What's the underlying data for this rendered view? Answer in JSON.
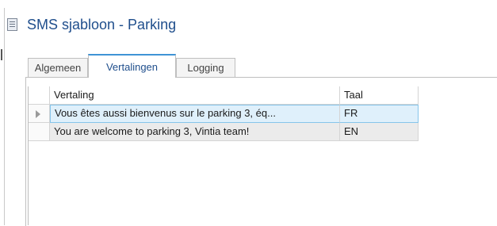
{
  "window": {
    "title": "SMS sjabloon - Parking"
  },
  "tabs": [
    {
      "label": "Algemeen"
    },
    {
      "label": "Vertalingen"
    },
    {
      "label": "Logging"
    }
  ],
  "grid": {
    "columns": [
      "Vertaling",
      "Taal"
    ],
    "rows": [
      {
        "vertaling": "Vous êtes aussi bienvenus sur le parking 3, éq...",
        "taal": "FR"
      },
      {
        "vertaling": "You are welcome to parking 3, Vintia team!",
        "taal": "EN"
      }
    ]
  },
  "colors": {
    "title": "#1f4e8c",
    "tab_accent": "#3f94d6",
    "selection": "#dff0fb"
  }
}
